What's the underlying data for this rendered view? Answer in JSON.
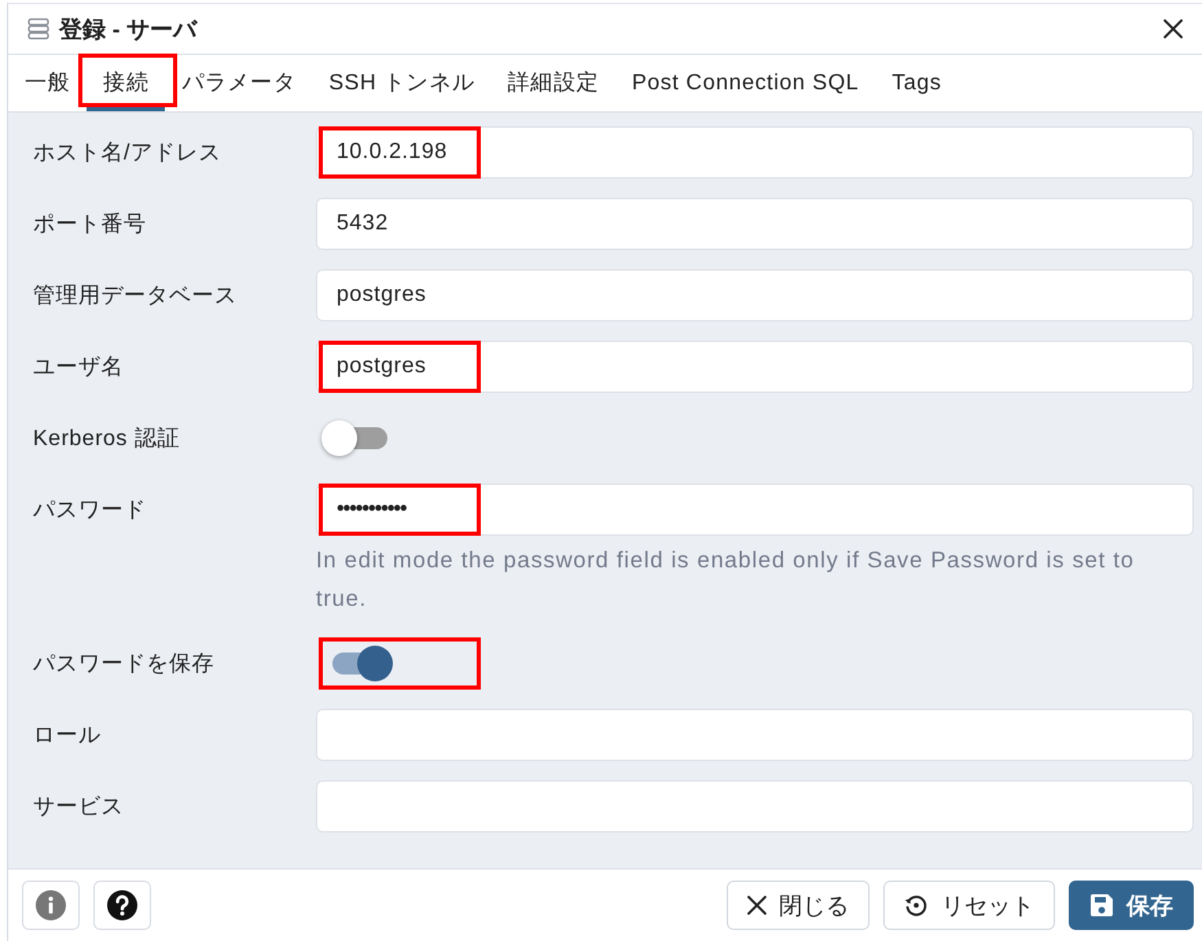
{
  "window": {
    "title": "登録 - サーバ"
  },
  "tabs": [
    {
      "label": "一般",
      "selected": false,
      "highlighted": false
    },
    {
      "label": "接続",
      "selected": true,
      "highlighted": true
    },
    {
      "label": "パラメータ",
      "selected": false,
      "highlighted": false
    },
    {
      "label": "SSH トンネル",
      "selected": false,
      "highlighted": false
    },
    {
      "label": "詳細設定",
      "selected": false,
      "highlighted": false
    },
    {
      "label": "Post Connection SQL",
      "selected": false,
      "highlighted": false
    },
    {
      "label": "Tags",
      "selected": false,
      "highlighted": false
    }
  ],
  "fields": [
    {
      "kind": "text",
      "label": "ホスト名/アドレス",
      "value": "10.0.2.198",
      "highlighted": true
    },
    {
      "kind": "text",
      "label": "ポート番号",
      "value": "5432",
      "highlighted": false
    },
    {
      "kind": "text",
      "label": "管理用データベース",
      "value": "postgres",
      "highlighted": false
    },
    {
      "kind": "text",
      "label": "ユーザ名",
      "value": "postgres",
      "highlighted": true
    },
    {
      "kind": "toggle",
      "label": "Kerberos 認証",
      "on": false,
      "highlighted": false
    },
    {
      "kind": "password",
      "label": "パスワード",
      "value": "•••••••••••",
      "highlighted": true,
      "help": "In edit mode the password field is enabled only if Save Password is set to true."
    },
    {
      "kind": "toggle",
      "label": "パスワードを保存",
      "on": true,
      "highlighted": true
    },
    {
      "kind": "text",
      "label": "ロール",
      "highlighted": false
    },
    {
      "kind": "text",
      "label": "サービス",
      "highlighted": false
    }
  ],
  "footer": {
    "buttons": [
      {
        "kind": "close",
        "label": "閉じる",
        "primary": false
      },
      {
        "kind": "reset",
        "label": "リセット",
        "primary": false
      },
      {
        "kind": "save",
        "label": "保存",
        "primary": true
      }
    ]
  }
}
